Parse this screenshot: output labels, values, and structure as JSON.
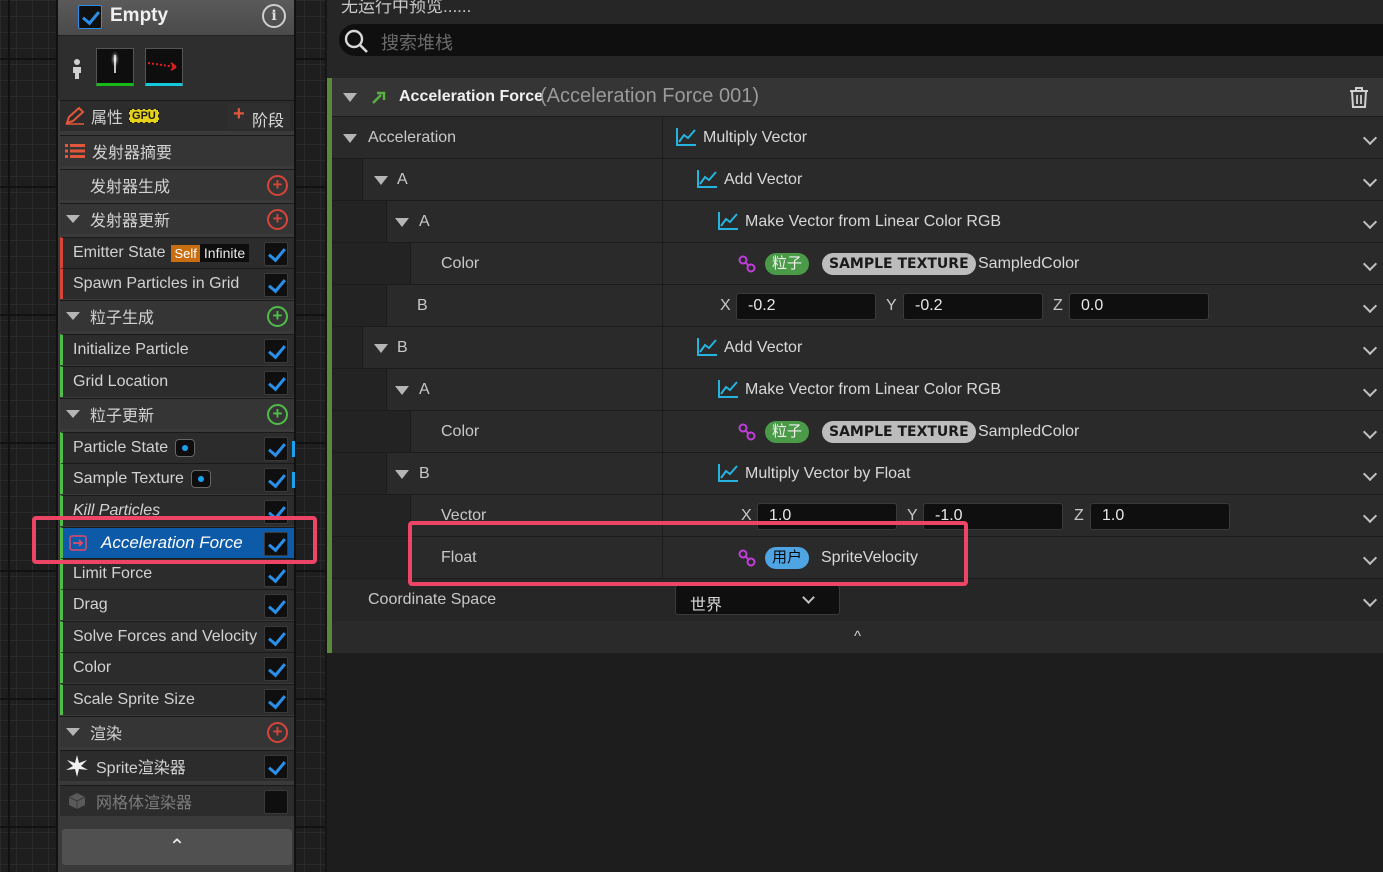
{
  "emitter": {
    "title": "Empty",
    "properties_label": "属性",
    "gpu_badge": "GPU",
    "stage_button": "阶段",
    "summary_label": "发射器摘要",
    "sections": {
      "emitter_spawn": "发射器生成",
      "emitter_update": "发射器更新",
      "particle_spawn": "粒子生成",
      "particle_update": "粒子更新",
      "render": "渲染"
    },
    "emitter_update_items": [
      {
        "label": "Emitter State",
        "self_badge": "Self",
        "infinite_badge": "Infinite"
      },
      {
        "label": "Spawn Particles in Grid"
      }
    ],
    "particle_spawn_items": [
      {
        "label": "Initialize Particle"
      },
      {
        "label": "Grid Location"
      }
    ],
    "particle_update_items": [
      {
        "label": "Particle State"
      },
      {
        "label": "Sample Texture"
      },
      {
        "label": "Kill Particles"
      },
      {
        "label": "Acceleration Force"
      },
      {
        "label": "Limit Force"
      },
      {
        "label": "Drag"
      },
      {
        "label": "Solve Forces and Velocity"
      },
      {
        "label": "Color"
      },
      {
        "label": "Scale Sprite Size"
      }
    ],
    "render_items": [
      {
        "label": "Sprite渲染器"
      },
      {
        "label": "网格体渲染器"
      }
    ],
    "collapse_glyph": "⌃"
  },
  "panel": {
    "preview_text": "无运行中预览......",
    "search_placeholder": "搜索堆栈",
    "module_title": "Acceleration Force",
    "module_subtitle": "(Acceleration Force 001)",
    "rows": {
      "acceleration": {
        "label": "Acceleration",
        "value": "Multiply Vector"
      },
      "a1": {
        "label": "A",
        "value": "Add Vector"
      },
      "a1_a": {
        "label": "A",
        "value": "Make Vector from Linear Color RGB"
      },
      "a1_a_color": {
        "label": "Color",
        "pill1": "粒子",
        "pill2": "SAMPLE TEXTURE",
        "value": "SampledColor"
      },
      "a1_b": {
        "label": "B",
        "x": "-0.2",
        "y": "-0.2",
        "z": "0.0"
      },
      "b1": {
        "label": "B",
        "value": "Add Vector"
      },
      "b1_a": {
        "label": "A",
        "value": "Make Vector from Linear Color RGB"
      },
      "b1_a_color": {
        "label": "Color",
        "pill1": "粒子",
        "pill2": "SAMPLE TEXTURE",
        "value": "SampledColor"
      },
      "b1_b": {
        "label": "B",
        "value": "Multiply Vector by Float"
      },
      "b1_b_vector": {
        "label": "Vector",
        "x": "1.0",
        "y": "-1.0",
        "z": "1.0"
      },
      "b1_b_float": {
        "label": "Float",
        "pill": "用户",
        "value": "SpriteVelocity"
      },
      "coord_space": {
        "label": "Coordinate Space",
        "value": "世界"
      }
    },
    "axis": {
      "x": "X",
      "y": "Y",
      "z": "Z"
    },
    "collapse_glyph": "^"
  },
  "colors": {
    "accent_blue": "#2a8fe8",
    "highlight": "#ee4466",
    "module_bar": "#5a8a38"
  }
}
